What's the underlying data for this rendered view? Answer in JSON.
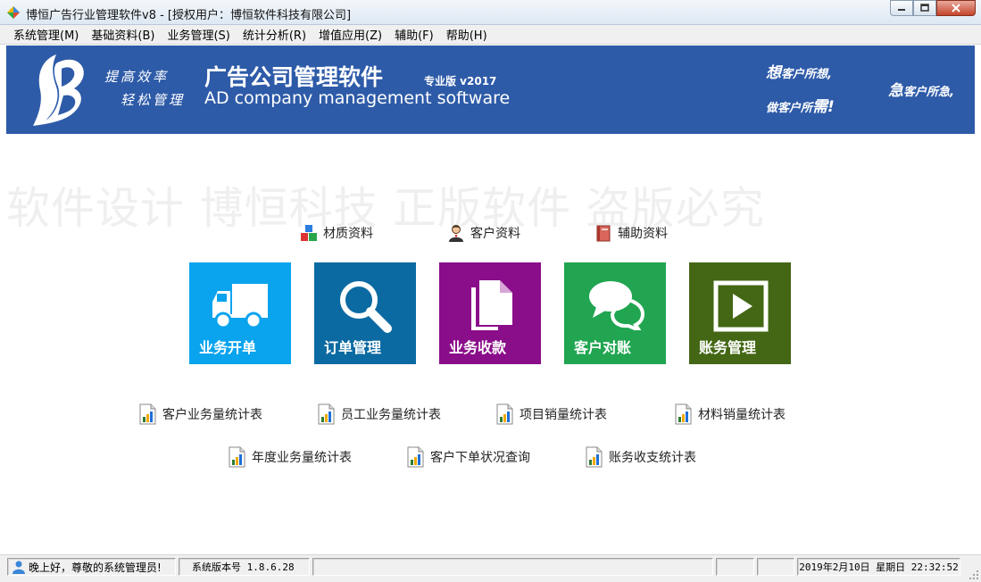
{
  "window": {
    "title": "博恒广告行业管理软件v8 - [授权用户：博恒软件科技有限公司]",
    "minimize_icon": "minimize-icon",
    "restore_icon": "restore-icon",
    "close_icon": "close-icon"
  },
  "menu": [
    {
      "label": "系统管理(M)"
    },
    {
      "label": "基础资料(B)"
    },
    {
      "label": "业务管理(S)"
    },
    {
      "label": "统计分析(R)"
    },
    {
      "label": "增值应用(Z)"
    },
    {
      "label": "辅助(F)"
    },
    {
      "label": "帮助(H)"
    }
  ],
  "banner": {
    "slogan_line1": "提高效率",
    "slogan_line2": "轻松管理",
    "product_name": "广告公司管理软件",
    "edition": "专业版 v2017",
    "product_name_en": "AD company management software",
    "tag1_big": "想",
    "tag1_rest": "客户所想,",
    "tag2_rest": "做客户所",
    "tag2_big": "需",
    "tag2_mark": "!",
    "tag3_big": "急",
    "tag3_rest": "客户所急,"
  },
  "watermark": "软件设计 博恒科技 正版软件 盗版必究",
  "quick_links": [
    {
      "label": "材质资料",
      "icon": "material-blocks-icon"
    },
    {
      "label": "客户资料",
      "icon": "customer-person-icon"
    },
    {
      "label": "辅助资料",
      "icon": "book-icon"
    }
  ],
  "tiles": [
    {
      "label": "业务开单",
      "icon": "truck-icon",
      "color": "#0aa4ee"
    },
    {
      "label": "订单管理",
      "icon": "magnifier-icon",
      "color": "#0c6aa2"
    },
    {
      "label": "业务收款",
      "icon": "documents-icon",
      "color": "#8a0d8a"
    },
    {
      "label": "客户对账",
      "icon": "chat-bubbles-icon",
      "color": "#21a551"
    },
    {
      "label": "账务管理",
      "icon": "play-icon",
      "color": "#436714"
    }
  ],
  "reports_row1": [
    {
      "label": "客户业务量统计表"
    },
    {
      "label": "员工业务量统计表"
    },
    {
      "label": "项目销量统计表"
    },
    {
      "label": "材料销量统计表"
    }
  ],
  "reports_row2": [
    {
      "label": "年度业务量统计表"
    },
    {
      "label": "客户下单状况查询"
    },
    {
      "label": "账务收支统计表"
    }
  ],
  "status": {
    "greeting": "晚上好，尊敬的系统管理员!",
    "version": "系统版本号 1.8.6.28",
    "datetime": "2019年2月10日 星期日 22:32:52"
  }
}
